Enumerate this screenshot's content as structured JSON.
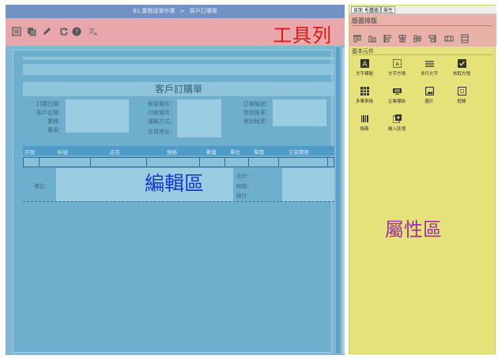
{
  "toolbar": {
    "breadcrumb": [
      "B1.業務接單作業",
      ">",
      "客戶訂購單"
    ],
    "label": "工具列",
    "buttons": [
      "list-icon",
      "copy-icon",
      "edit-icon",
      "refresh-icon",
      "help-icon",
      "translate-icon"
    ]
  },
  "editor": {
    "label": "編輯區",
    "form_title": "客戶訂購單",
    "fields_left": [
      "訂購日期：",
      "客戶名稱：",
      "業務：",
      "專案："
    ],
    "fields_mid": [
      "貿易條件：",
      "付款條件：",
      "運輸方式：",
      "交貨地址："
    ],
    "fields_right": [
      "訂單編號：",
      "幣別匯率：",
      "稅別稅率："
    ],
    "table_headers": [
      "序號",
      "料號",
      "品名",
      "規格",
      "數量",
      "單位",
      "單價",
      "交貨期限"
    ],
    "note_label": "備註：",
    "totals": [
      "合計：",
      "稅額：",
      "總計："
    ]
  },
  "props": {
    "label": "屬性區",
    "tabs": [
      "頁面",
      "基本",
      "屬性"
    ],
    "align_title": "版面排版",
    "basic_title": "基本元件",
    "elements": [
      {
        "label": "文字標題",
        "icon": "text-title-icon"
      },
      {
        "label": "文字方塊",
        "icon": "text-box-icon"
      },
      {
        "label": "多行文字",
        "icon": "multiline-text-icon"
      },
      {
        "label": "核取方塊",
        "icon": "checkbox-icon"
      },
      {
        "label": "多筆表格",
        "icon": "table-icon"
      },
      {
        "label": "企業標誌",
        "icon": "logo-icon"
      },
      {
        "label": "圖片",
        "icon": "image-icon"
      },
      {
        "label": "框線",
        "icon": "border-icon"
      },
      {
        "label": "條碼",
        "icon": "barcode-icon"
      },
      {
        "label": "嵌入區塊",
        "icon": "embed-block-icon"
      }
    ]
  }
}
